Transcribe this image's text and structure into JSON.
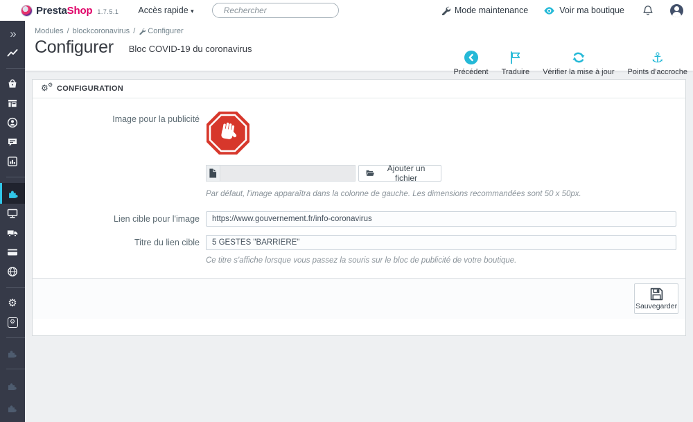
{
  "header": {
    "logo_presta": "Presta",
    "logo_shop": "Shop",
    "version": "1.7.5.1",
    "quick_access_label": "Accès rapide",
    "quick_access_caret": "▾",
    "search_placeholder": "Rechercher",
    "maintenance_label": "Mode maintenance",
    "view_shop_label": "Voir ma boutique"
  },
  "breadcrumb": {
    "separator": "/",
    "items": [
      "Modules",
      "blockcoronavirus",
      "Configurer"
    ]
  },
  "page": {
    "title": "Configurer",
    "subtitle": "Bloc COVID-19 du coronavirus"
  },
  "toolbar": {
    "buttons": [
      {
        "icon": "back-circle-icon",
        "label": "Précédent"
      },
      {
        "icon": "flag-icon",
        "label": "Traduire"
      },
      {
        "icon": "sync-icon",
        "label": "Vérifier la mise à jour"
      },
      {
        "icon": "anchor-icon",
        "label": "Points d'accroche",
        "anchor_glyph": "⚓"
      }
    ]
  },
  "sidebar": {
    "icons": [
      "double-chevron-icon",
      "dashboard-chart-icon",
      "orders-bag-icon",
      "catalog-store-icon",
      "customers-icon",
      "customer-service-chat-icon",
      "stats-icon",
      "modules-puzzle-icon",
      "design-monitor-icon",
      "shipping-truck-icon",
      "payment-card-icon",
      "international-globe-icon",
      "shop-parameters-gear-icon",
      "advanced-parameters-gear-icon",
      "module-puzzle-dim-icon",
      "module-puzzle-dim-icon",
      "module-puzzle-dim-icon"
    ],
    "gear_glyph": "⚙",
    "chevron_glyph": "»"
  },
  "panel": {
    "title": "CONFIGURATION",
    "cog_glyph": "⚙"
  },
  "form": {
    "image_label": "Image pour la publicité",
    "file_button_label": "Ajouter un fichier",
    "image_help": "Par défaut, l'image apparaîtra dans la colonne de gauche. Les dimensions recommandées sont 50 x 50px.",
    "link_label": "Lien cible pour l'image",
    "link_value": "https://www.gouvernement.fr/info-coronavirus",
    "title_label": "Titre du lien cible",
    "title_value": "5 GESTES \"BARRIÈRE\"",
    "title_help": "Ce titre s'affiche lorsque vous passez la souris sur le bloc de publicité de votre boutique.",
    "save_label": "Sauvegarder"
  },
  "colors": {
    "accent_cyan": "#25b9d7",
    "brand_pink": "#df0067",
    "sidebar_bg": "#363a48",
    "active_icon_cyan": "#31c6e8",
    "stop_sign_red": "#d7372b"
  }
}
